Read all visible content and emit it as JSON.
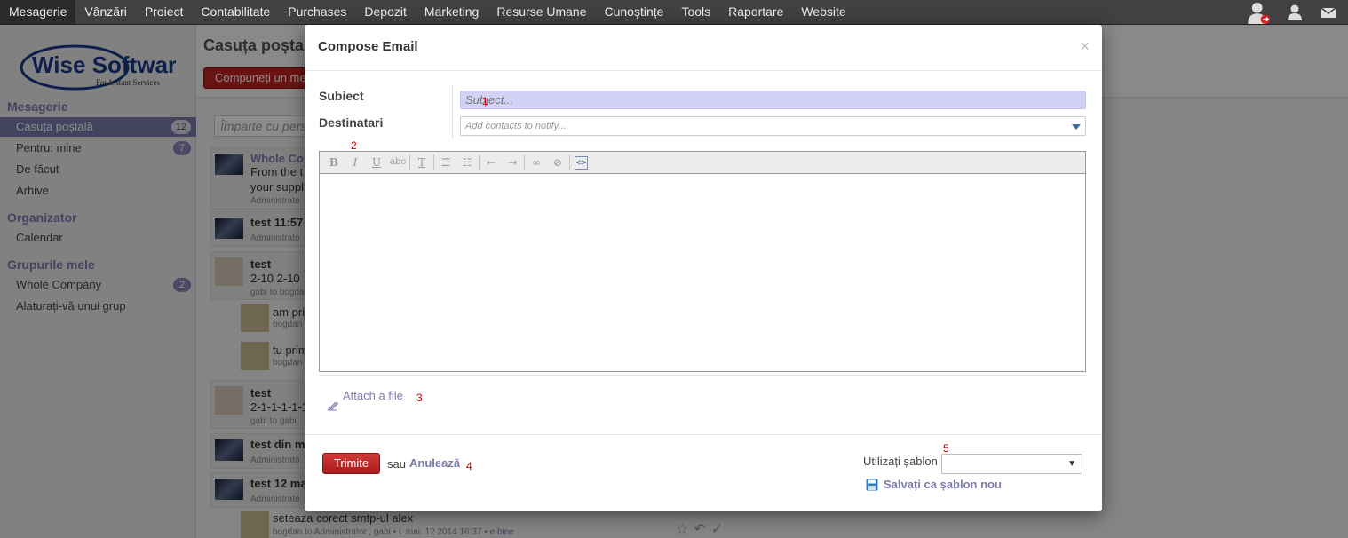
{
  "topbar": {
    "menu": [
      "Mesagerie",
      "Vânzări",
      "Proiect",
      "Contabilitate",
      "Purchases",
      "Depozit",
      "Marketing",
      "Resurse Umane",
      "Cunoștințe",
      "Tools",
      "Raportare",
      "Website"
    ]
  },
  "logo": {
    "brand": "Wise Software",
    "tagline": "For Instant Services"
  },
  "sidebar": {
    "sections": [
      {
        "title": "Mesagerie",
        "items": [
          {
            "label": "Casuța poștală",
            "badge": "12",
            "active": true
          },
          {
            "label": "Pentru: mine",
            "badge": "7"
          },
          {
            "label": "De făcut"
          },
          {
            "label": "Arhive"
          }
        ]
      },
      {
        "title": "Organizator",
        "items": [
          {
            "label": "Calendar"
          }
        ]
      },
      {
        "title": "Grupurile mele",
        "items": [
          {
            "label": "Whole Company",
            "badge": "2"
          },
          {
            "label": "Alaturați-vă unui grup"
          }
        ]
      }
    ]
  },
  "main": {
    "title": "Casuța poștală",
    "compose_button": "Compuneți un mesaj",
    "share_placeholder": "Împarte cu persoanele",
    "messages": [
      {
        "title": "Whole Co",
        "line1": "From the t",
        "line2": "your suppl",
        "meta": "Administrato"
      },
      {
        "title": "test 11:57",
        "meta": "Administrato"
      },
      {
        "title": "test",
        "line1": "2-10 2-10",
        "meta_a": "gabi",
        "meta_b": "to",
        "meta_c": "bogdan"
      },
      {
        "title": "test",
        "line1": "2-1-1-1-1-1",
        "meta_a": "gabi",
        "meta_b": "to",
        "meta_c": "gabi"
      },
      {
        "title": "test din m",
        "meta": "Administrato"
      },
      {
        "title": "test 12 ma",
        "meta": "Administrato"
      }
    ],
    "replies": [
      {
        "text": "am pri",
        "meta": "bogdan"
      },
      {
        "text": "tu prim",
        "meta": "bogdan"
      }
    ],
    "bottom": {
      "text": "seteaza corect smtp-ul alex",
      "meta_from": "bogdan",
      "meta_to_word": "to",
      "meta_to": "Administrator , gabi",
      "meta_date": "• L mai. 12 2014 16:37 •",
      "meta_link": "e bine"
    }
  },
  "modal": {
    "title": "Compose Email",
    "close": "×",
    "subject_label": "Subiect",
    "subject_placeholder": "Subject...",
    "recipients_label": "Destinatari",
    "contacts_placeholder": "Add contacts to notify...",
    "toolbar": {
      "bold": "B",
      "italic": "I",
      "underline": "U",
      "strike": "abc",
      "clear": "T",
      "bullets": "☰",
      "numbers": "☷",
      "outdent": "⇤",
      "indent": "⇥",
      "link": "∞",
      "unlink": "⊘",
      "code": "<>"
    },
    "attach_label": "Attach a file",
    "send_button": "Trimite",
    "or_text": "sau",
    "cancel_link": "Anulează",
    "template_label": "Utilizați șablon",
    "template_selected": "",
    "save_template": "Salvați ca șablon nou",
    "annotations": [
      "1",
      "2",
      "3",
      "4",
      "5"
    ]
  }
}
